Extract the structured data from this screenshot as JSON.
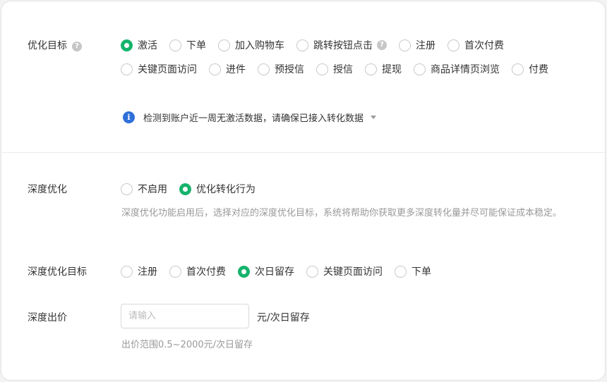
{
  "optimization_goal": {
    "label": "优化目标",
    "help_icon": "question-icon",
    "options_row1": [
      {
        "label": "激活",
        "checked": true
      },
      {
        "label": "下单",
        "checked": false
      },
      {
        "label": "加入购物车",
        "checked": false
      },
      {
        "label": "跳转按钮点击",
        "checked": false,
        "help": true
      },
      {
        "label": "注册",
        "checked": false
      },
      {
        "label": "首次付费",
        "checked": false
      }
    ],
    "options_row2": [
      {
        "label": "关键页面访问",
        "checked": false
      },
      {
        "label": "进件",
        "checked": false
      },
      {
        "label": "预授信",
        "checked": false
      },
      {
        "label": "授信",
        "checked": false
      },
      {
        "label": "提现",
        "checked": false
      },
      {
        "label": "商品详情页浏览",
        "checked": false
      },
      {
        "label": "付费",
        "checked": false
      }
    ],
    "notice": {
      "icon": "info-icon",
      "text": "检测到账户近一周无激活数据，请确保已接入转化数据"
    }
  },
  "deep_optimization": {
    "label": "深度优化",
    "options": [
      {
        "label": "不启用",
        "checked": false
      },
      {
        "label": "优化转化行为",
        "checked": true
      }
    ],
    "description": "深度优化功能启用后，选择对应的深度优化目标，系统将帮助你获取更多深度转化量并尽可能保证成本稳定。"
  },
  "deep_goal": {
    "label": "深度优化目标",
    "options": [
      {
        "label": "注册",
        "checked": false
      },
      {
        "label": "首次付费",
        "checked": false
      },
      {
        "label": "次日留存",
        "checked": true
      },
      {
        "label": "关键页面访问",
        "checked": false
      },
      {
        "label": "下单",
        "checked": false
      }
    ]
  },
  "deep_bid": {
    "label": "深度出价",
    "placeholder": "请输入",
    "value": "",
    "unit": "元/次日留存",
    "hint": "出价范围0.5~2000元/次日留存"
  },
  "colors": {
    "accent": "#16b36c",
    "info": "#2f6fd9",
    "muted_text": "#999999",
    "border": "#d9d9d9"
  }
}
